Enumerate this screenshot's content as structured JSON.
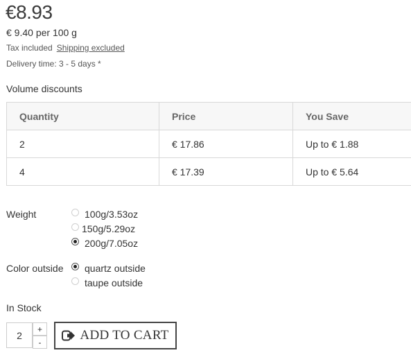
{
  "price": {
    "main": "€8.93",
    "unit": "€ 9.40 per 100 g",
    "tax_included": "Tax included",
    "shipping_link": "Shipping excluded",
    "delivery": "Delivery time: 3 - 5 days *"
  },
  "volume_discounts": {
    "title": "Volume discounts",
    "headers": [
      "Quantity",
      "Price",
      "You Save"
    ],
    "rows": [
      [
        "2",
        "€ 17.86",
        "Up to € 1.88"
      ],
      [
        "4",
        "€ 17.39",
        "Up to € 5.64"
      ]
    ]
  },
  "weight": {
    "label": "Weight",
    "options": [
      "100g/3.53oz",
      "150g/5.29oz",
      "200g/7.05oz"
    ],
    "selected": "200g/7.05oz"
  },
  "color_outside": {
    "label": "Color outside",
    "options": [
      "quartz outside",
      "taupe outside"
    ],
    "selected": "quartz outside"
  },
  "stock": "In Stock",
  "cart": {
    "quantity": "2",
    "plus": "+",
    "minus": "-",
    "button_label": "ADD TO CART",
    "button_icon": "sign-in-icon"
  }
}
